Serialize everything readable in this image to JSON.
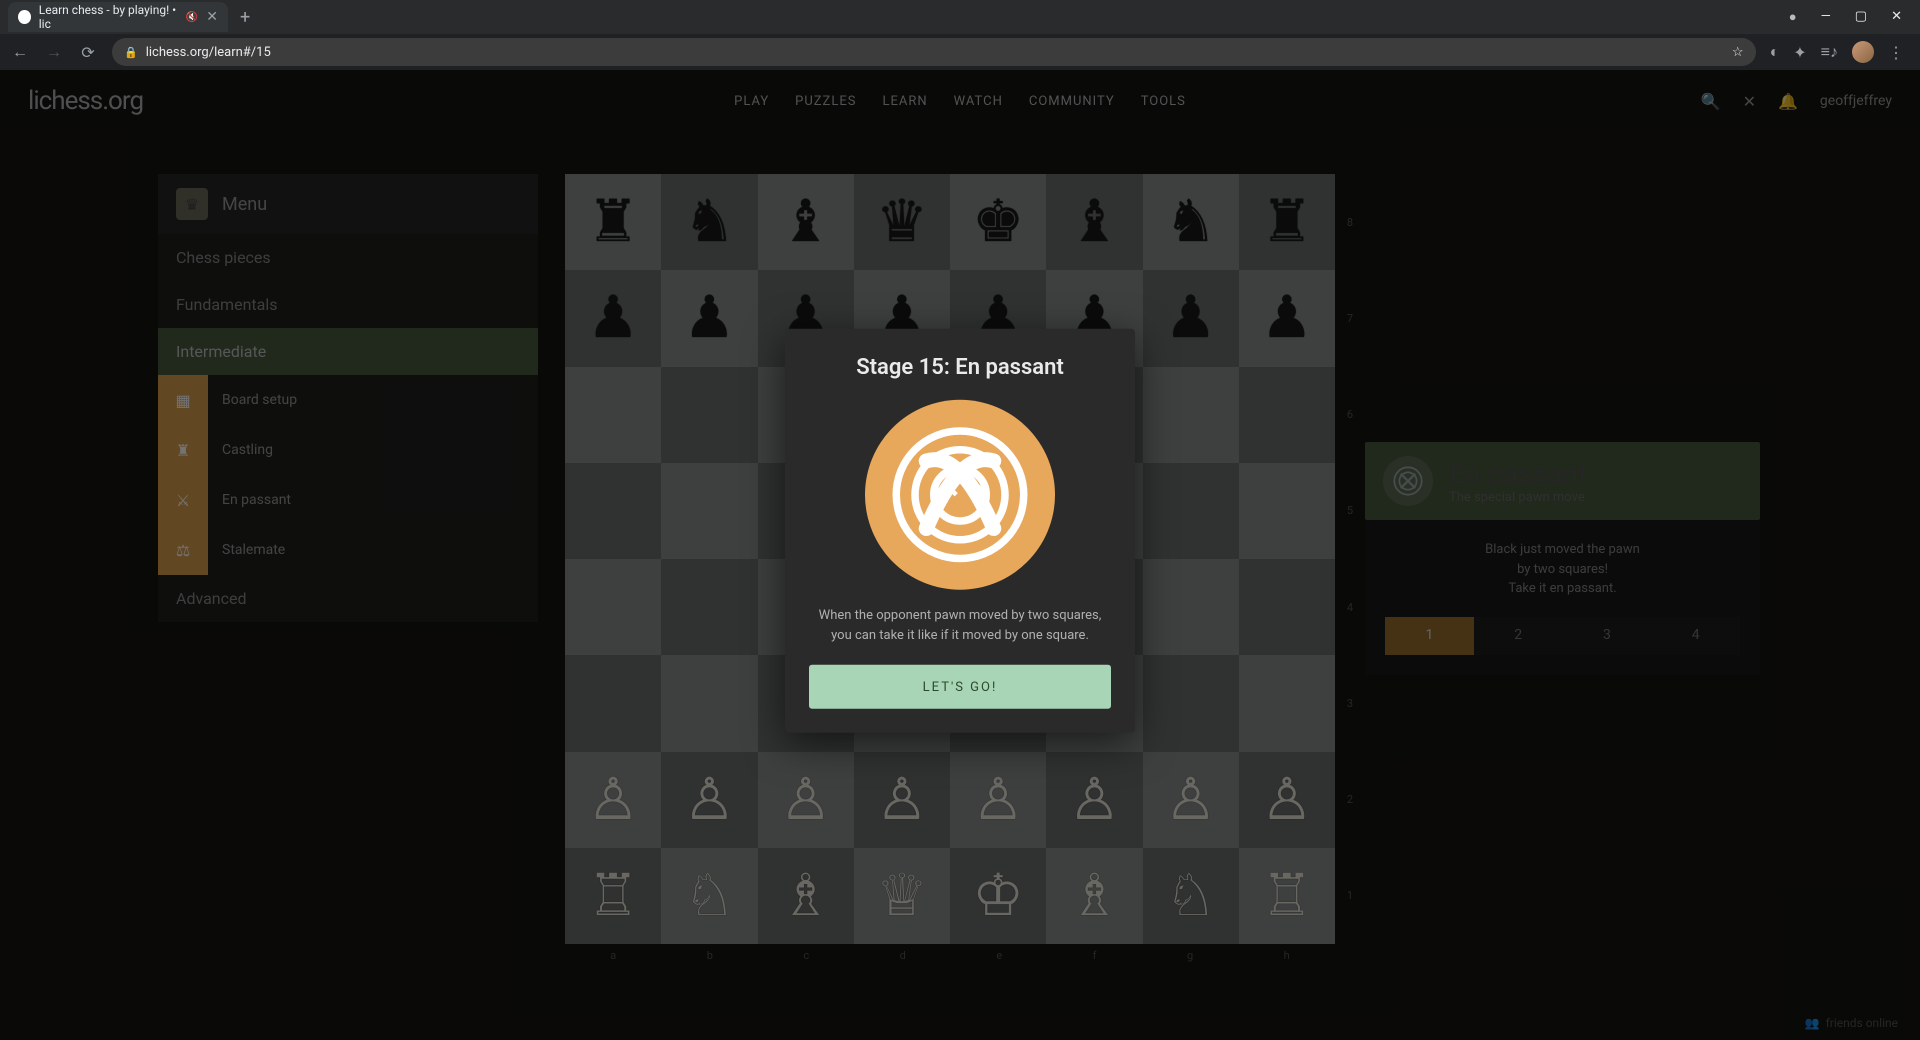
{
  "browser": {
    "tab_title": "Learn chess - by playing! • lic",
    "url": "lichess.org/learn#/15",
    "win_min": "—",
    "win_max": "▢",
    "win_close": "✕",
    "new_tab": "+",
    "sound_icon": "🔇",
    "tab_close": "✕",
    "back": "←",
    "forward": "→",
    "reload": "⟳",
    "lock": "🔒",
    "star": "☆",
    "ext1": "◐",
    "ext2": "✦",
    "ext3": "≡♪",
    "menu": "⋮",
    "record": "●"
  },
  "header": {
    "logo": "lichess.org",
    "nav": [
      "PLAY",
      "PUZZLES",
      "LEARN",
      "WATCH",
      "COMMUNITY",
      "TOOLS"
    ],
    "search_icon": "🔍",
    "challenge_icon": "✕",
    "bell_icon": "🔔",
    "username": "geoffjeffrey"
  },
  "sidebar": {
    "menu_label": "Menu",
    "categories": {
      "pieces": "Chess pieces",
      "fundamentals": "Fundamentals",
      "intermediate": "Intermediate",
      "advanced": "Advanced"
    },
    "intermediate_items": [
      {
        "label": "Board setup",
        "active_icon": true
      },
      {
        "label": "Castling",
        "active_icon": true
      },
      {
        "label": "En passant",
        "active_icon": true
      },
      {
        "label": "Stalemate",
        "active_icon": true
      }
    ]
  },
  "board": {
    "ranks": [
      "8",
      "7",
      "6",
      "5",
      "4",
      "3",
      "2",
      "1"
    ],
    "files": [
      "a",
      "b",
      "c",
      "d",
      "e",
      "f",
      "g",
      "h"
    ],
    "rows": [
      [
        "r",
        "n",
        "b",
        "q",
        "k",
        "b",
        "n",
        "r"
      ],
      [
        "p",
        "p",
        "p",
        "p",
        "p",
        "p",
        "p",
        "p"
      ],
      [
        "",
        "",
        "",
        "",
        "",
        "",
        "",
        ""
      ],
      [
        "",
        "",
        "",
        "",
        "",
        "",
        "",
        ""
      ],
      [
        "",
        "",
        "",
        "",
        "",
        "",
        "",
        ""
      ],
      [
        "",
        "",
        "",
        "",
        "",
        "",
        "",
        ""
      ],
      [
        "P",
        "P",
        "P",
        "P",
        "P",
        "P",
        "P",
        "P"
      ],
      [
        "R",
        "N",
        "B",
        "Q",
        "K",
        "B",
        "N",
        "R"
      ]
    ]
  },
  "rightpanel": {
    "title": "En passant",
    "subtitle": "The special pawn move",
    "body_line1": "Black just moved the pawn",
    "body_line2": "by two squares!",
    "body_line3": "Take it en passant.",
    "steps": [
      "1",
      "2",
      "3",
      "4"
    ],
    "active_step": 0
  },
  "modal": {
    "title": "Stage 15: En passant",
    "desc": "When the opponent pawn moved by two squares, you can take it like if it moved by one square.",
    "button": "LET'S GO!"
  },
  "footer": {
    "friends": "friends online"
  },
  "pieces_map": {
    "K": "♔",
    "Q": "♕",
    "R": "♖",
    "B": "♗",
    "N": "♘",
    "P": "♙",
    "k": "♚",
    "q": "♛",
    "r": "♜",
    "b": "♝",
    "n": "♞",
    "p": "♟"
  }
}
